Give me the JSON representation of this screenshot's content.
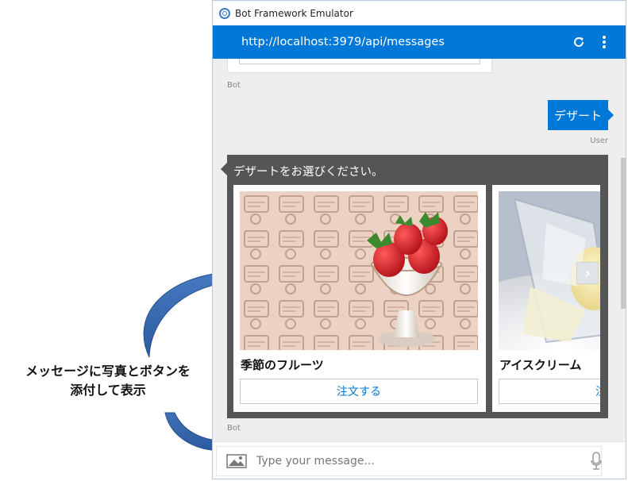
{
  "annotation": {
    "line1": "メッセージに写真とボタンを",
    "line2": "添付して表示"
  },
  "window": {
    "title": "Bot Framework Emulator",
    "url": "http://localhost:3979/api/messages"
  },
  "chat": {
    "bot_label": "Bot",
    "user_label": "User",
    "user_message": "デザート",
    "bot_message": "デザートをお選びください。",
    "cards": [
      {
        "title": "季節のフルーツ",
        "button": "注文する"
      },
      {
        "title": "アイスクリーム",
        "button": "注文する"
      }
    ]
  },
  "composer": {
    "placeholder": "Type your message..."
  },
  "colors": {
    "accent": "#0078d7",
    "bot_bubble": "#555555",
    "chat_bg": "#eeeeee"
  },
  "icons": [
    "app-logo-icon",
    "refresh-icon",
    "more-vertical-icon",
    "chevron-right-icon",
    "image-attach-icon",
    "microphone-icon"
  ]
}
